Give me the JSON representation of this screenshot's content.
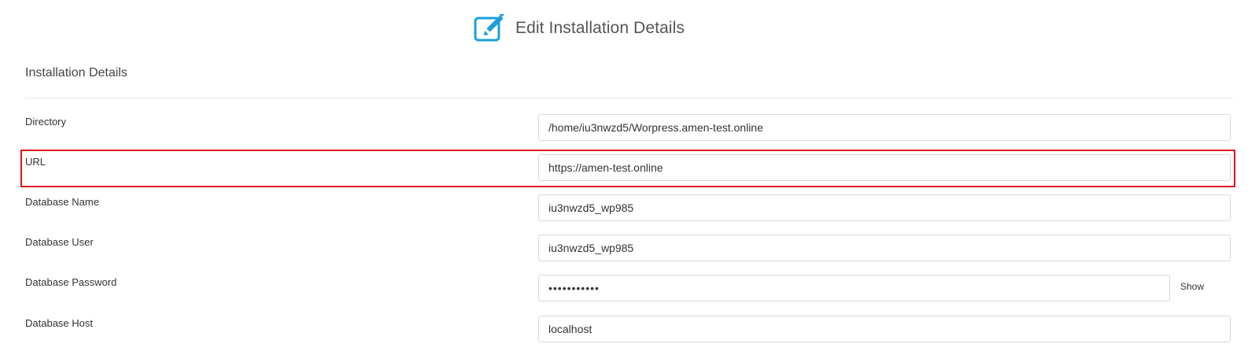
{
  "header": {
    "title": "Edit Installation Details",
    "icon": "edit-icon",
    "icon_color": "#1a9fd9"
  },
  "section": {
    "title": "Installation Details"
  },
  "fields": {
    "directory": {
      "label": "Directory",
      "value": "/home/iu3nwzd5/Worpress.amen-test.online"
    },
    "url": {
      "label": "URL",
      "value": "https://amen-test.online"
    },
    "db_name": {
      "label": "Database Name",
      "value": "iu3nwzd5_wp985"
    },
    "db_user": {
      "label": "Database User",
      "value": "iu3nwzd5_wp985"
    },
    "db_password": {
      "label": "Database Password",
      "value": "•••••••••••",
      "toggle_label": "Show"
    },
    "db_host": {
      "label": "Database Host",
      "value": "localhost"
    }
  },
  "highlight": {
    "target": "url-row",
    "color": "#e0141f"
  }
}
